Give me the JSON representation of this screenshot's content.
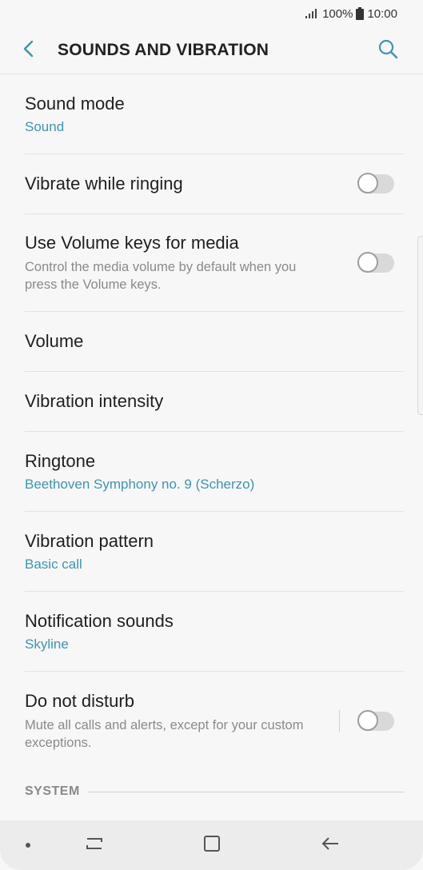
{
  "status": {
    "battery_text": "100%",
    "time": "10:00"
  },
  "header": {
    "title": "SOUNDS AND VIBRATION"
  },
  "items": [
    {
      "title": "Sound mode",
      "subtitle": "Sound"
    },
    {
      "title": "Vibrate while ringing",
      "toggle": false
    },
    {
      "title": "Use Volume keys for media",
      "description": "Control the media volume by default when you press the Volume keys.",
      "toggle": false
    },
    {
      "title": "Volume"
    },
    {
      "title": "Vibration intensity"
    },
    {
      "title": "Ringtone",
      "subtitle": "Beethoven Symphony no. 9 (Scherzo)"
    },
    {
      "title": "Vibration pattern",
      "subtitle": "Basic call"
    },
    {
      "title": "Notification sounds",
      "subtitle": "Skyline"
    },
    {
      "title": "Do not disturb",
      "description": "Mute all calls and alerts, except for your custom exceptions.",
      "toggle": false
    }
  ],
  "section": {
    "label": "SYSTEM"
  },
  "colors": {
    "accent": "#3d95b0",
    "toggle_off": "#d9d9d9"
  },
  "icons": [
    "signal-icon",
    "battery-icon",
    "back-arrow-icon",
    "search-icon",
    "recent-apps-icon",
    "home-icon",
    "back-icon"
  ]
}
